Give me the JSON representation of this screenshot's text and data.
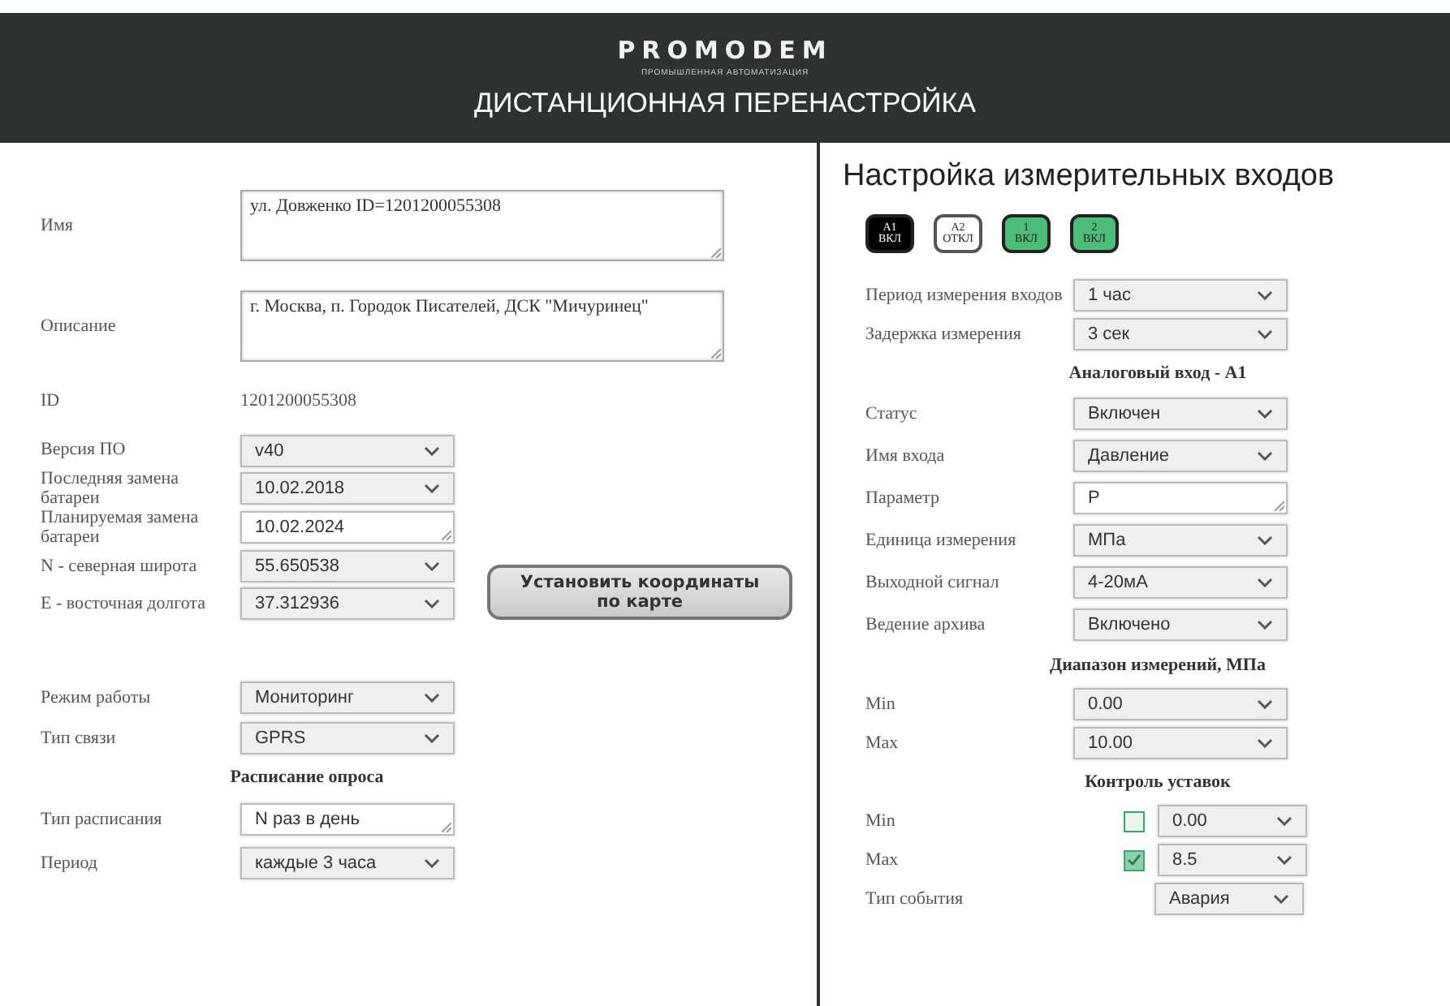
{
  "header": {
    "logo": "PROMODEM",
    "tagline": "ПРОМЫШЛЕННАЯ АВТОМАТИЗАЦИЯ",
    "title": "ДИСТАНЦИОННАЯ ПЕРЕНАСТРОЙКА"
  },
  "left": {
    "name": {
      "label": "Имя",
      "value": "ул. Довженко ID=1201200055308"
    },
    "description": {
      "label": "Описание",
      "value": "г. Москва, п. Городок Писателей, ДСК \"Мичуринец\""
    },
    "id": {
      "label": "ID",
      "value": "1201200055308"
    },
    "device_fields": [
      {
        "label": "Версия ПО",
        "value": "v40",
        "kind": "select"
      },
      {
        "label": "Последняя замена батареи",
        "value": "10.02.2018",
        "kind": "select"
      },
      {
        "label": "Планируемая замена батареи",
        "value": "10.02.2024",
        "kind": "text"
      },
      {
        "label": "N - северная широта",
        "value": "55.650538",
        "kind": "select"
      },
      {
        "label": "E - восточная долгота",
        "value": "37.312936",
        "kind": "select"
      }
    ],
    "map_button": "Установить координаты по карте",
    "mode_fields": [
      {
        "label": "Режим работы",
        "value": "Мониторинг",
        "kind": "select"
      },
      {
        "label": "Тип связи",
        "value": "GPRS",
        "kind": "select"
      }
    ],
    "schedule_heading": "Расписание опроса",
    "schedule_fields": [
      {
        "label": "Тип расписания",
        "value": "N раз в день",
        "kind": "text"
      },
      {
        "label": "Период",
        "value": "каждые 3 часа",
        "kind": "select"
      }
    ]
  },
  "right": {
    "title": "Настройка измерительных входов",
    "inputs": [
      {
        "name": "A1",
        "state": "ВКЛ",
        "selected": true,
        "on": true
      },
      {
        "name": "A2",
        "state": "ОТКЛ",
        "selected": false,
        "on": false
      },
      {
        "name": "1",
        "state": "ВКЛ",
        "selected": false,
        "on": true
      },
      {
        "name": "2",
        "state": "ВКЛ",
        "selected": false,
        "on": true
      }
    ],
    "general_fields": [
      {
        "label": "Период измерения входов",
        "value": "1 час",
        "kind": "select"
      },
      {
        "label": "Задержка измерения",
        "value": "3 сек",
        "kind": "select"
      }
    ],
    "analog_heading": "Аналоговый вход - A1",
    "analog_fields": [
      {
        "label": "Статус",
        "value": "Включен",
        "kind": "select"
      },
      {
        "label": "Имя входа",
        "value": "Давление",
        "kind": "select"
      },
      {
        "label": "Параметр",
        "value": "P",
        "kind": "text"
      },
      {
        "label": "Единица измерения",
        "value": "МПа",
        "kind": "select"
      },
      {
        "label": "Выходной сигнал",
        "value": "4-20мА",
        "kind": "select"
      },
      {
        "label": "Ведение архива",
        "value": "Включено",
        "kind": "select"
      }
    ],
    "range_heading": "Диапазон измерений, МПа",
    "range_fields": [
      {
        "label": "Min",
        "value": "0.00",
        "kind": "select"
      },
      {
        "label": "Max",
        "value": "10.00",
        "kind": "select"
      }
    ],
    "setpoint_heading": "Контроль уставок",
    "setpoint_fields": [
      {
        "label": "Min",
        "value": "0.00",
        "checked": false,
        "kind": "check"
      },
      {
        "label": "Max",
        "value": "8.5",
        "checked": true,
        "kind": "check"
      },
      {
        "label": "Тип события",
        "value": "Авария",
        "kind": "plain"
      }
    ]
  }
}
